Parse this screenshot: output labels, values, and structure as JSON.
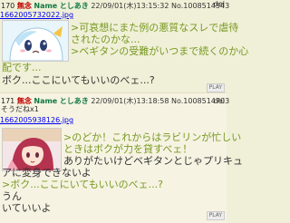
{
  "posts": [
    {
      "number": "170",
      "anon_label": "無念",
      "name_label": "Name",
      "author": "としあき",
      "datetime": "22/09/01(木)13:15:32",
      "id": "No.1008514543",
      "delete_label": "del",
      "filename": "1662005732022.jpg",
      "quote_lines": [
        ">可哀想にまた例の悪質なスレで虐待",
        "されたのかな...",
        ">ベギタンの受難がいつまで続くのか心",
        "配です..."
      ],
      "plain_lines": [
        "ボク...ここにいてもいいのべェ...?"
      ],
      "play_label": "PLAY"
    },
    {
      "number": "171",
      "anon_label": "無念",
      "name_label": "Name",
      "author": "としあき",
      "datetime": "22/09/01(木)13:18:58",
      "id": "No.1008514703",
      "delete_label": "del",
      "soudane": "そうだねx1",
      "filename": "1662005938126.jpg",
      "quote_lines": [
        ">のどか！これからはラビリンが忙しい",
        "ときはボクが力を貸すべェ！"
      ],
      "plain_lines": [
        "ありがたいけどベギタンとじゃプリキュ",
        "アに変身できないよ"
      ],
      "quote_lines2": [
        ">ボク...ここにいてもいいのべェ...?"
      ],
      "plain_lines2": [
        "うん",
        "いていいよ"
      ],
      "play_label": "PLAY"
    }
  ]
}
